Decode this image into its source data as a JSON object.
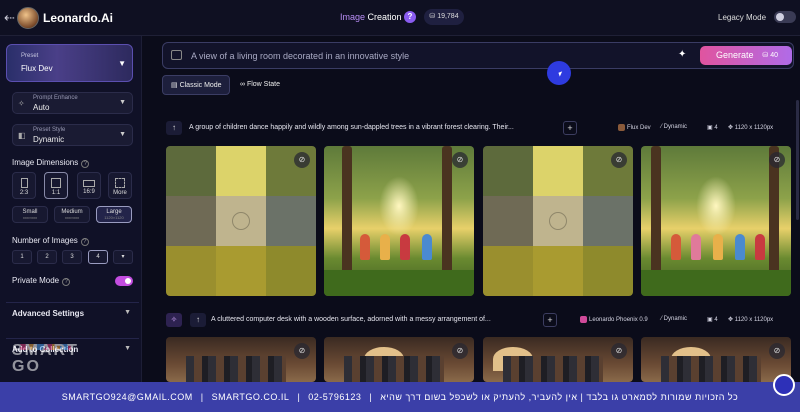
{
  "topbar": {
    "back_icon": "arrow-left-icon",
    "brand": "Leonardo.Ai",
    "title_part1": "Image",
    "title_part2": "Creation",
    "help": "?",
    "tokens": "19,784",
    "legacy_mode_label": "Legacy Mode"
  },
  "sidebar": {
    "preset_label": "Preset",
    "preset_value": "Flux Dev",
    "prompt_enhance_label": "Prompt Enhance",
    "prompt_enhance_value": "Auto",
    "preset_style_label": "Preset Style",
    "preset_style_value": "Dynamic",
    "image_dimensions_label": "Image Dimensions",
    "ratios": [
      "2:3",
      "1:1",
      "16:9",
      "More"
    ],
    "sizes": [
      {
        "label": "Small",
        "sub": "xxx×xxx"
      },
      {
        "label": "Medium",
        "sub": "xxx×xxx"
      },
      {
        "label": "Large",
        "sub": "1120×1120"
      }
    ],
    "number_of_images_label": "Number of Images",
    "numbers": [
      "1",
      "2",
      "3",
      "4"
    ],
    "private_mode_label": "Private Mode",
    "advanced_settings_label": "Advanced Settings",
    "add_to_collection_label": "Add to Collection",
    "watermark_line1": "SMART",
    "watermark_line2": "GO"
  },
  "prompt": {
    "text": "A view of a living room decorated in an innovative style",
    "generate_label": "Generate",
    "generate_cost": "40"
  },
  "modes": [
    "Classic Mode",
    "Flow State"
  ],
  "generations": [
    {
      "prompt": "A group of children dance happily and wildly among sun-dappled trees in a vibrant forest clearing. Their...",
      "model": "Flux Dev",
      "style": "Dynamic",
      "count": "4",
      "dimensions": "1120 x 1120px"
    },
    {
      "prompt": "A cluttered computer desk with a wooden surface, adorned with a messy arrangement of...",
      "model": "Leonardo Phoenix 0.9",
      "style": "Dynamic",
      "count": "4",
      "dimensions": "1120 x 1120px"
    }
  ],
  "footer": {
    "email": "SMARTGO924@GMAIL.COM",
    "site": "SMARTGO.CO.IL",
    "phone": "02-5796123",
    "notice": "כל הזכויות שמורות לסמארט גו בלבד | אין להעביר, להעתיק או לשכפל בשום דרך שהיא"
  },
  "colors": {
    "accent_purple": "#8a5cf0",
    "generate_gradient_start": "#e0549f",
    "generate_gradient_end": "#b06be8",
    "footer_bar": "#3b3fa8"
  }
}
